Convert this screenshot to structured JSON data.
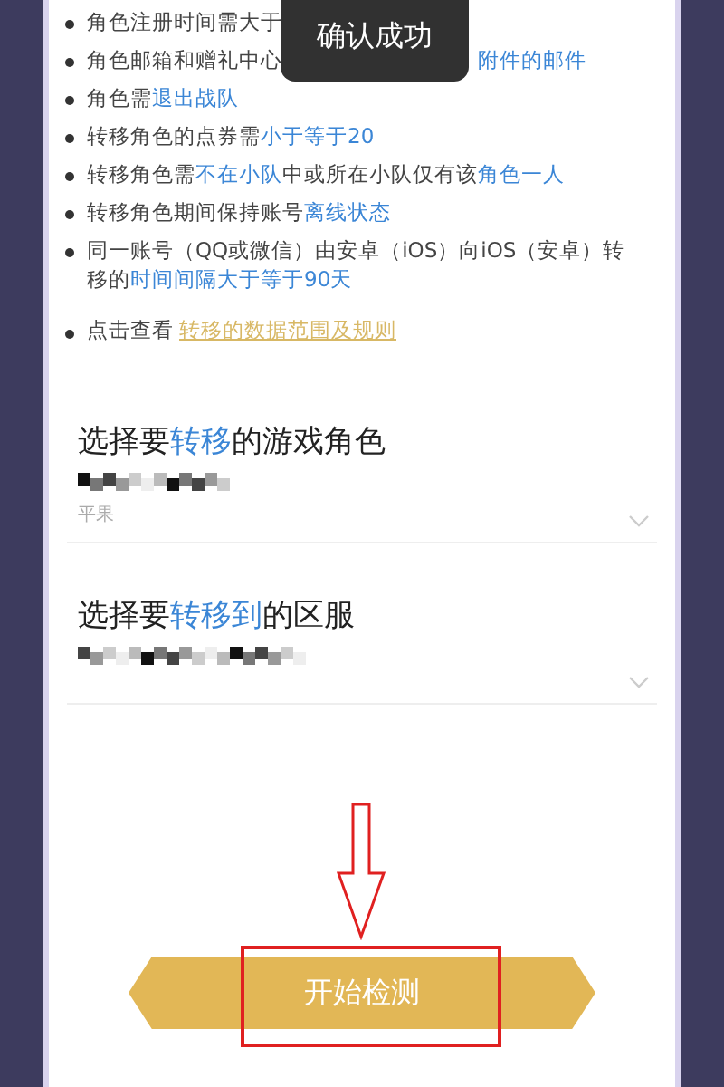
{
  "toast": {
    "text": "确认成功"
  },
  "rules": [
    {
      "kind": "covered",
      "parts": [
        {
          "text": "角色注册时间需大于",
          "highlight": false
        }
      ]
    },
    {
      "kind": "covered",
      "parts": [
        {
          "text": "角色邮箱和赠礼中心",
          "highlight": false
        },
        {
          "text": "附件的邮件",
          "highlight": true
        }
      ]
    },
    {
      "parts": [
        {
          "text": "角色需",
          "highlight": false
        },
        {
          "text": "退出战队",
          "highlight": true
        }
      ]
    },
    {
      "parts": [
        {
          "text": "转移角色的点券需",
          "highlight": false
        },
        {
          "text": "小于等于20",
          "highlight": true
        }
      ]
    },
    {
      "parts": [
        {
          "text": "转移角色需",
          "highlight": false
        },
        {
          "text": "不在小队",
          "highlight": true
        },
        {
          "text": "中或所在小队仅有该",
          "highlight": false
        },
        {
          "text": "角色一人",
          "highlight": true
        }
      ]
    },
    {
      "parts": [
        {
          "text": "转移角色期间保持账号",
          "highlight": false
        },
        {
          "text": "离线状态",
          "highlight": true
        }
      ]
    },
    {
      "parts": [
        {
          "text": "同一账号（QQ或微信）由安卓（iOS）向iOS（安卓）转移的",
          "highlight": false
        },
        {
          "text": "时间间隔大于等于90天",
          "highlight": true
        }
      ]
    }
  ],
  "rules_link": {
    "prefix": "点击查看",
    "link": "转移的数据范围及规则"
  },
  "sections": [
    {
      "title": [
        {
          "text": "选择要",
          "highlight": false
        },
        {
          "text": "转移",
          "highlight": true
        },
        {
          "text": "的游戏角色",
          "highlight": false
        }
      ],
      "sub": "平果"
    },
    {
      "title": [
        {
          "text": "选择要",
          "highlight": false
        },
        {
          "text": "转移到",
          "highlight": true
        },
        {
          "text": "的区服",
          "highlight": false
        }
      ]
    }
  ],
  "button": {
    "label": "开始检测"
  }
}
